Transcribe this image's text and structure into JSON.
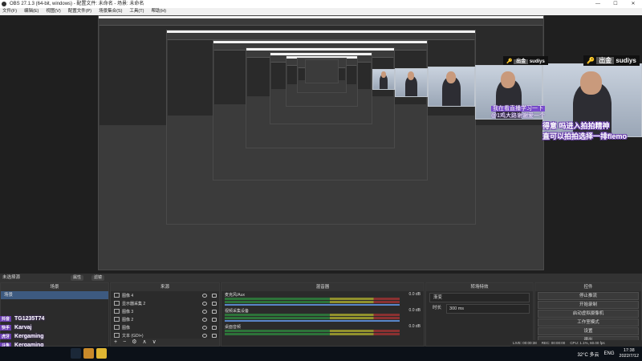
{
  "window": {
    "title": "OBS 27.1.3 (64-bit, windows) - 配置文件: 未命名 - 场景: 未命名",
    "min": "—",
    "max": "☐",
    "close": "✕"
  },
  "menu": [
    "文件(F)",
    "编辑(E)",
    "视图(V)",
    "配置文件(P)",
    "场景集合(S)",
    "工具(T)",
    "帮助(H)"
  ],
  "camera_tags": [
    {
      "name": "sudiys",
      "prefix": "出金"
    }
  ],
  "danmu": {
    "line1": "我在看直播学习一下",
    "line2": "@1鸡大路谢谢爱一个"
  },
  "big_message": {
    "line1": "得意 吗进入拍拍精神",
    "line2": "直可以拍拍选择一排flemo"
  },
  "scene_bar": {
    "title": "未选择源",
    "tab1": "属性",
    "tab2": "滤镜"
  },
  "docks": {
    "scenes": {
      "title": "场景",
      "items": [
        "场景"
      ]
    },
    "sources": {
      "title": "来源",
      "items": [
        {
          "label": "图像 4"
        },
        {
          "label": "显示器采集 2"
        },
        {
          "label": "图像 3"
        },
        {
          "label": "图像 2"
        },
        {
          "label": "图像"
        },
        {
          "label": "文本 (GDI+)"
        }
      ],
      "tools": [
        "+",
        "−",
        "⚙",
        "∧",
        "∨"
      ]
    },
    "mixer": {
      "title": "混音器",
      "channels": [
        {
          "name": "麦克风/Aux",
          "db": "0.0 dB"
        },
        {
          "name": "视频采集设备",
          "db": "0.0 dB"
        },
        {
          "name": "桌面音频",
          "db": "0.0 dB"
        }
      ]
    },
    "transitions": {
      "title": "转场特效",
      "type": "渐变",
      "duration_label": "时长",
      "duration": "300 ms"
    },
    "controls": {
      "title": "控件",
      "buttons": [
        "停止推流",
        "开始录制",
        "启动虚拟摄像机",
        "工作室模式",
        "设置",
        "退出"
      ]
    }
  },
  "overlay_names": [
    {
      "platform": "抖音",
      "name": "TG1235T74"
    },
    {
      "platform": "快手",
      "name": "Karvaj"
    },
    {
      "platform": "虎牙",
      "name": "Kergaming"
    },
    {
      "platform": "斗鱼",
      "name": "Kergaming"
    }
  ],
  "status_bar": {
    "live": "LIVE: 00:00:38",
    "rec": "REC: 00:00:00",
    "cpu": "CPU: 1.1%, 60.00 fps"
  },
  "taskbar": {
    "weather": "32°C 多云",
    "lang": "ENG",
    "time": "17:38",
    "date": "2022/7/12"
  },
  "colors": {
    "accent": "#3d5a80",
    "danmu": "#6b3fb0"
  }
}
